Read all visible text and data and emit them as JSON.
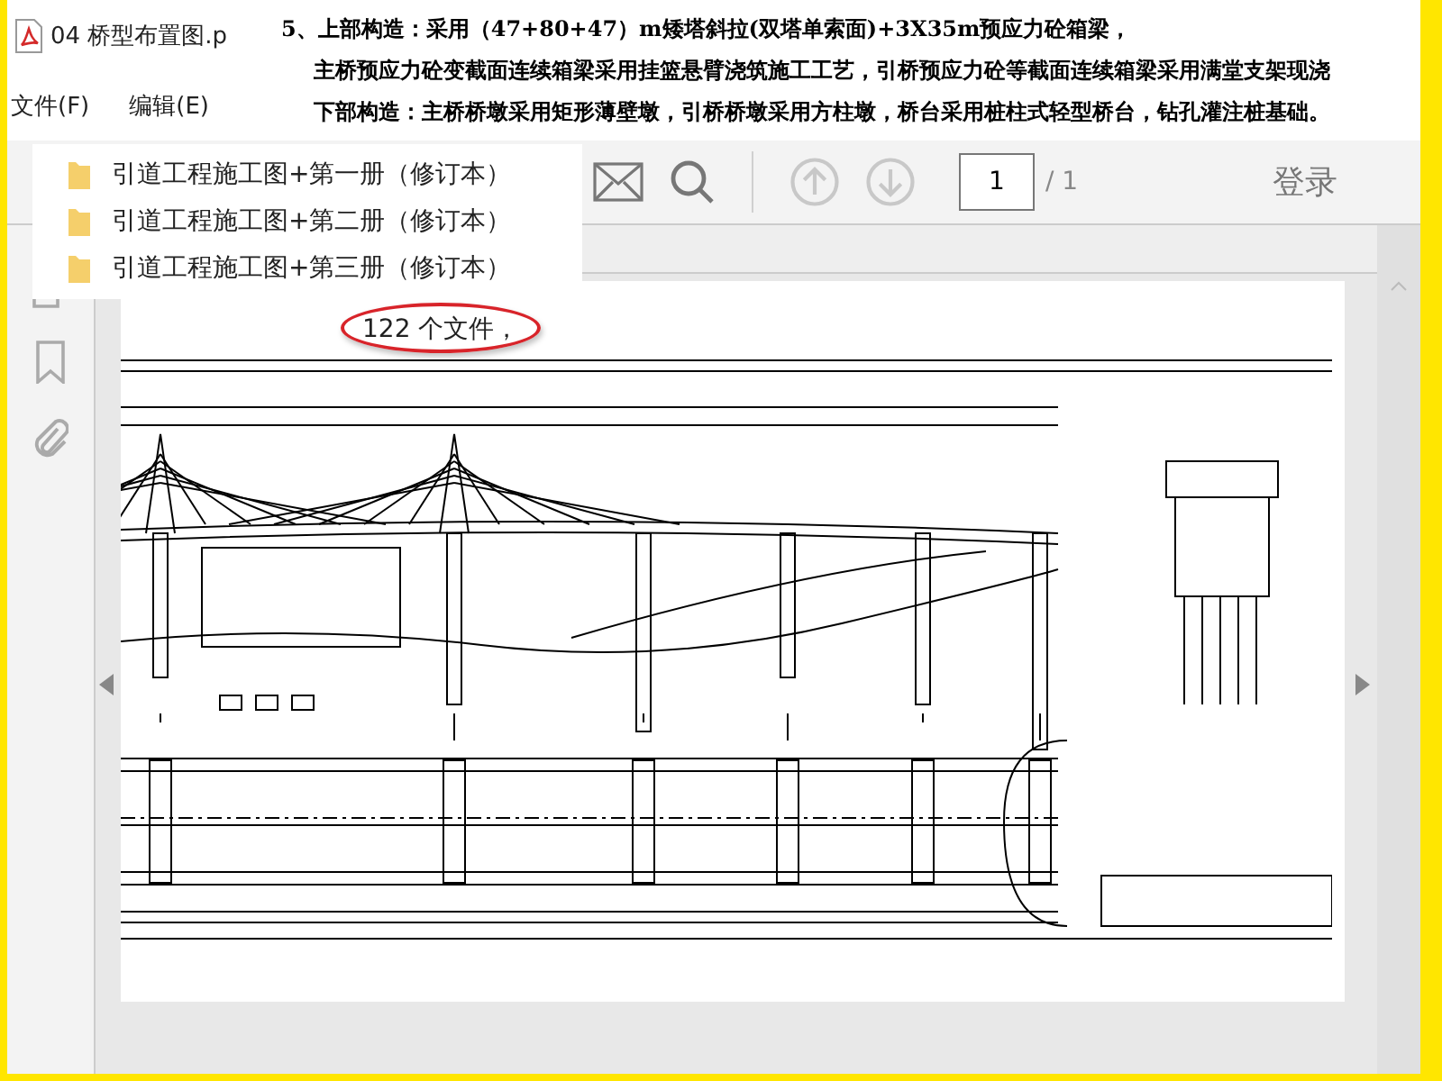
{
  "title_bar": {
    "file_name": "04 桥型布置图.p"
  },
  "menu": [
    "文件(F)",
    "编辑(E)"
  ],
  "overlay_text": {
    "lines": [
      "5、上部构造：采用（47+80+47）m矮塔斜拉(双塔单索面)+3X35m预应力砼箱梁，",
      "主桥预应力砼变截面连续箱梁采用挂篮悬臂浇筑施工工艺，引桥预应力砼等截面连续箱梁采用满堂支架现浇",
      "下部构造：主桥桥墩采用矩形薄壁墩，引桥桥墩采用方柱墩，桥台采用桩柱式轻型桥台，钻孔灌注桩基础。"
    ]
  },
  "folder_list": [
    {
      "name": "引道工程施工图+第一册（修订本）"
    },
    {
      "name": "引道工程施工图+第二册（修订本）"
    },
    {
      "name": "引道工程施工图+第三册（修订本）"
    }
  ],
  "toolbar": {
    "nav_buttons": [
      {
        "kind": "up",
        "disabled": true
      },
      {
        "kind": "down",
        "disabled": true
      }
    ],
    "page_number": "1",
    "page_total": "/ 1",
    "login": "登录"
  },
  "document": {
    "file_count": "122 个文件，"
  }
}
